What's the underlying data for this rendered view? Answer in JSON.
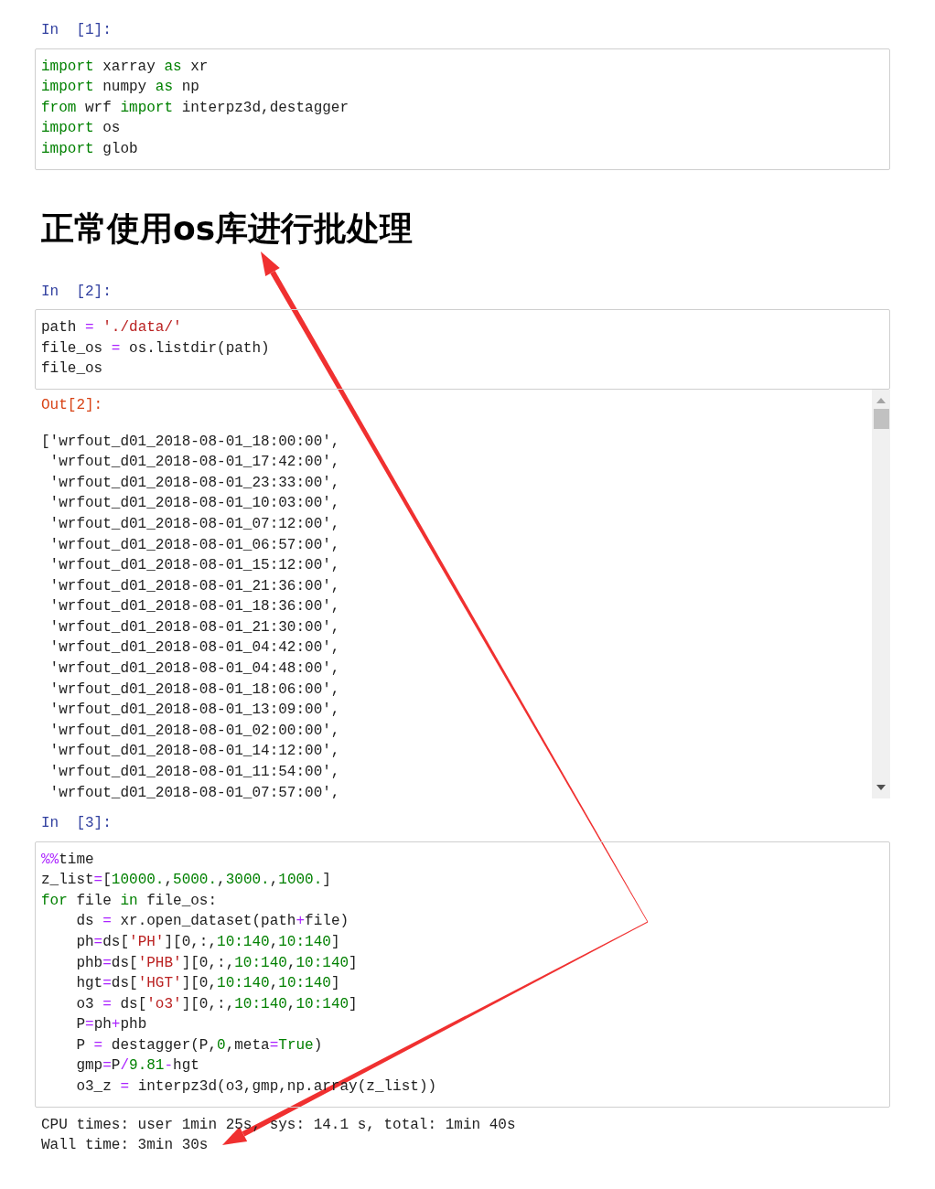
{
  "cells": [
    {
      "kind": "code",
      "prompt": "In  [1]:",
      "lines": [
        [
          {
            "text": "import",
            "kind": "keyword"
          },
          {
            "text": " xarray ",
            "kind": "plain"
          },
          {
            "text": "as",
            "kind": "keyword"
          },
          {
            "text": " xr",
            "kind": "plain"
          }
        ],
        [
          {
            "text": "import",
            "kind": "keyword"
          },
          {
            "text": " numpy ",
            "kind": "plain"
          },
          {
            "text": "as",
            "kind": "keyword"
          },
          {
            "text": " np",
            "kind": "plain"
          }
        ],
        [
          {
            "text": "from",
            "kind": "keyword"
          },
          {
            "text": " wrf ",
            "kind": "plain"
          },
          {
            "text": "import",
            "kind": "keyword"
          },
          {
            "text": " interpz3d,destagger",
            "kind": "plain"
          }
        ],
        [
          {
            "text": "import",
            "kind": "keyword"
          },
          {
            "text": " os",
            "kind": "plain"
          }
        ],
        [
          {
            "text": "import",
            "kind": "keyword"
          },
          {
            "text": " glob",
            "kind": "plain"
          }
        ]
      ]
    },
    {
      "kind": "heading",
      "text": "正常使用os库进行批处理"
    },
    {
      "kind": "code",
      "prompt": "In  [2]:",
      "lines": [
        [
          {
            "text": "path ",
            "kind": "plain"
          },
          {
            "text": "=",
            "kind": "operator"
          },
          {
            "text": " './data/'",
            "kind": "string"
          }
        ],
        [
          {
            "text": "file_os ",
            "kind": "plain"
          },
          {
            "text": "=",
            "kind": "operator"
          },
          {
            "text": " os.listdir(path)",
            "kind": "plain"
          }
        ],
        [
          {
            "text": "file_os",
            "kind": "plain"
          }
        ]
      ],
      "output": {
        "prompt": "Out[2]:",
        "lines": [
          "['wrfout_d01_2018-08-01_18:00:00',",
          " 'wrfout_d01_2018-08-01_17:42:00',",
          " 'wrfout_d01_2018-08-01_23:33:00',",
          " 'wrfout_d01_2018-08-01_10:03:00',",
          " 'wrfout_d01_2018-08-01_07:12:00',",
          " 'wrfout_d01_2018-08-01_06:57:00',",
          " 'wrfout_d01_2018-08-01_15:12:00',",
          " 'wrfout_d01_2018-08-01_21:36:00',",
          " 'wrfout_d01_2018-08-01_18:36:00',",
          " 'wrfout_d01_2018-08-01_21:30:00',",
          " 'wrfout_d01_2018-08-01_04:42:00',",
          " 'wrfout_d01_2018-08-01_04:48:00',",
          " 'wrfout_d01_2018-08-01_18:06:00',",
          " 'wrfout_d01_2018-08-01_13:09:00',",
          " 'wrfout_d01_2018-08-01_02:00:00',",
          " 'wrfout_d01_2018-08-01_14:12:00',",
          " 'wrfout_d01_2018-08-01_11:54:00',",
          " 'wrfout_d01_2018-08-01_07:57:00',"
        ],
        "scrollable": true
      }
    },
    {
      "kind": "code",
      "prompt": "In  [3]:",
      "lines": [
        [
          {
            "text": "%%",
            "kind": "magic"
          },
          {
            "text": "time",
            "kind": "plain"
          }
        ],
        [
          {
            "text": "z_list",
            "kind": "plain"
          },
          {
            "text": "=",
            "kind": "operator"
          },
          {
            "text": "[",
            "kind": "plain"
          },
          {
            "text": "10000.",
            "kind": "number"
          },
          {
            "text": ",",
            "kind": "plain"
          },
          {
            "text": "5000.",
            "kind": "number"
          },
          {
            "text": ",",
            "kind": "plain"
          },
          {
            "text": "3000.",
            "kind": "number"
          },
          {
            "text": ",",
            "kind": "plain"
          },
          {
            "text": "1000.",
            "kind": "number"
          },
          {
            "text": "]",
            "kind": "plain"
          }
        ],
        [
          {
            "text": "for",
            "kind": "keyword"
          },
          {
            "text": " file ",
            "kind": "plain"
          },
          {
            "text": "in",
            "kind": "keyword"
          },
          {
            "text": " file_os:",
            "kind": "plain"
          }
        ],
        [
          {
            "text": "    ds ",
            "kind": "plain"
          },
          {
            "text": "=",
            "kind": "operator"
          },
          {
            "text": " xr.open_dataset(path",
            "kind": "plain"
          },
          {
            "text": "+",
            "kind": "operator"
          },
          {
            "text": "file)",
            "kind": "plain"
          }
        ],
        [
          {
            "text": "    ph",
            "kind": "plain"
          },
          {
            "text": "=",
            "kind": "operator"
          },
          {
            "text": "ds[",
            "kind": "plain"
          },
          {
            "text": "'PH'",
            "kind": "string"
          },
          {
            "text": "][0,:,",
            "kind": "plain"
          },
          {
            "text": "10:140",
            "kind": "number"
          },
          {
            "text": ",",
            "kind": "plain"
          },
          {
            "text": "10:140",
            "kind": "number"
          },
          {
            "text": "]",
            "kind": "plain"
          }
        ],
        [
          {
            "text": "    phb",
            "kind": "plain"
          },
          {
            "text": "=",
            "kind": "operator"
          },
          {
            "text": "ds[",
            "kind": "plain"
          },
          {
            "text": "'PHB'",
            "kind": "string"
          },
          {
            "text": "][0,:,",
            "kind": "plain"
          },
          {
            "text": "10:140",
            "kind": "number"
          },
          {
            "text": ",",
            "kind": "plain"
          },
          {
            "text": "10:140",
            "kind": "number"
          },
          {
            "text": "]",
            "kind": "plain"
          }
        ],
        [
          {
            "text": "    hgt",
            "kind": "plain"
          },
          {
            "text": "=",
            "kind": "operator"
          },
          {
            "text": "ds[",
            "kind": "plain"
          },
          {
            "text": "'HGT'",
            "kind": "string"
          },
          {
            "text": "][0,",
            "kind": "plain"
          },
          {
            "text": "10:140",
            "kind": "number"
          },
          {
            "text": ",",
            "kind": "plain"
          },
          {
            "text": "10:140",
            "kind": "number"
          },
          {
            "text": "]",
            "kind": "plain"
          }
        ],
        [
          {
            "text": "    o3 ",
            "kind": "plain"
          },
          {
            "text": "=",
            "kind": "operator"
          },
          {
            "text": " ds[",
            "kind": "plain"
          },
          {
            "text": "'o3'",
            "kind": "string"
          },
          {
            "text": "][0,:,",
            "kind": "plain"
          },
          {
            "text": "10:140",
            "kind": "number"
          },
          {
            "text": ",",
            "kind": "plain"
          },
          {
            "text": "10:140",
            "kind": "number"
          },
          {
            "text": "]",
            "kind": "plain"
          }
        ],
        [
          {
            "text": "    P",
            "kind": "plain"
          },
          {
            "text": "=",
            "kind": "operator"
          },
          {
            "text": "ph",
            "kind": "plain"
          },
          {
            "text": "+",
            "kind": "operator"
          },
          {
            "text": "phb",
            "kind": "plain"
          }
        ],
        [
          {
            "text": "    P ",
            "kind": "plain"
          },
          {
            "text": "=",
            "kind": "operator"
          },
          {
            "text": " destagger(P,",
            "kind": "plain"
          },
          {
            "text": "0",
            "kind": "number"
          },
          {
            "text": ",meta",
            "kind": "plain"
          },
          {
            "text": "=",
            "kind": "operator"
          },
          {
            "text": "True",
            "kind": "keyword"
          },
          {
            "text": ")",
            "kind": "plain"
          }
        ],
        [
          {
            "text": "    gmp",
            "kind": "plain"
          },
          {
            "text": "=",
            "kind": "operator"
          },
          {
            "text": "P",
            "kind": "plain"
          },
          {
            "text": "/",
            "kind": "operator"
          },
          {
            "text": "9.81",
            "kind": "number"
          },
          {
            "text": "-",
            "kind": "operator"
          },
          {
            "text": "hgt",
            "kind": "plain"
          }
        ],
        [
          {
            "text": "    o3_z ",
            "kind": "plain"
          },
          {
            "text": "=",
            "kind": "operator"
          },
          {
            "text": " interpz3d(o3,gmp,np.array(z_list))",
            "kind": "plain"
          }
        ]
      ],
      "output": {
        "lines": [
          "CPU times: user 1min 25s, sys: 14.1 s, total: 1min 40s",
          "Wall time: 3min 30s"
        ],
        "scrollable": false
      }
    }
  ],
  "annotations": [
    {
      "kind": "arrow"
    },
    {
      "kind": "arrow"
    }
  ]
}
